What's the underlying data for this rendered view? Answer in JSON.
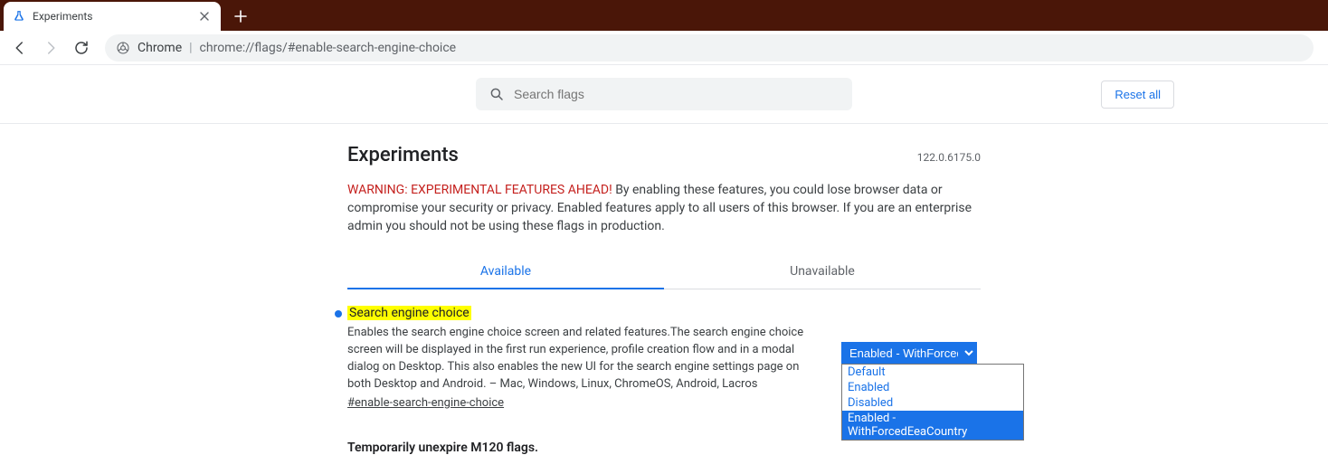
{
  "tab": {
    "title": "Experiments"
  },
  "toolbar": {
    "addr_scheme": "Chrome",
    "addr_url": "chrome://flags/#enable-search-engine-choice"
  },
  "search": {
    "placeholder": "Search flags"
  },
  "reset_label": "Reset all",
  "page_title": "Experiments",
  "version": "122.0.6175.0",
  "warning_prefix": "WARNING: EXPERIMENTAL FEATURES AHEAD!",
  "warning_rest": " By enabling these features, you could lose browser data or compromise your security or privacy. Enabled features apply to all users of this browser. If you are an enterprise admin you should not be using these flags in production.",
  "tabs": {
    "available": "Available",
    "unavailable": "Unavailable"
  },
  "flag": {
    "title": "Search engine choice",
    "desc": "Enables the search engine choice screen and related features.The search engine choice screen will be displayed in the first run experience, profile creation flow and in a modal dialog on Desktop. This also enables the new UI for the search engine settings page on both Desktop and Android. – Mac, Windows, Linux, ChromeOS, Android, Lacros",
    "hash": "#enable-search-engine-choice",
    "selected": "Enabled - WithForcedEeaCountry",
    "options": [
      "Default",
      "Enabled",
      "Disabled",
      "Enabled - WithForcedEeaCountry"
    ]
  },
  "next_flag_title": "Temporarily unexpire M120 flags."
}
